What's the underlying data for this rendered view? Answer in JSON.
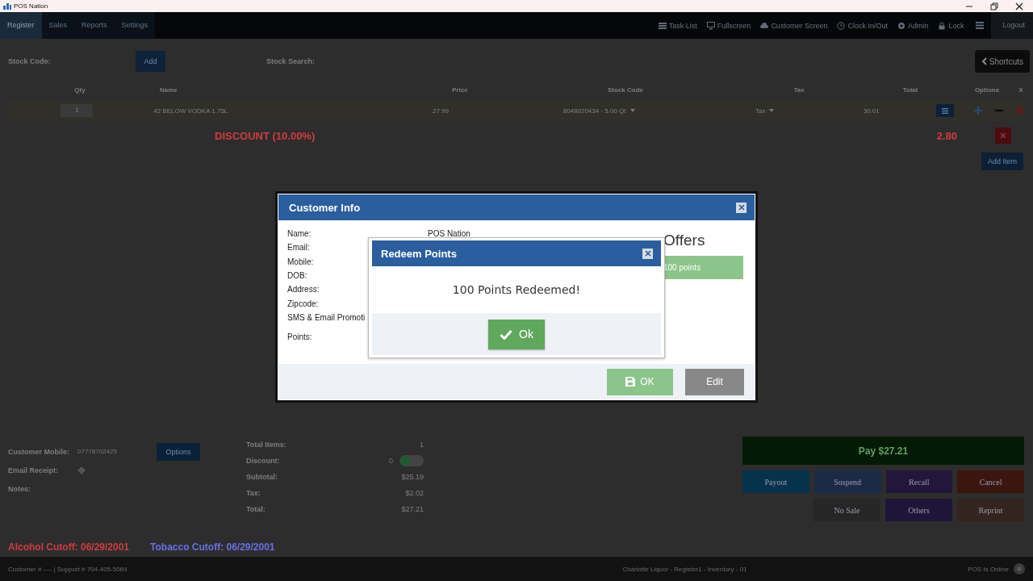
{
  "window": {
    "title": "POS Nation"
  },
  "nav": {
    "tabs": [
      {
        "label": "Register",
        "selected": true
      },
      {
        "label": "Sales",
        "selected": false
      },
      {
        "label": "Reports",
        "selected": false
      },
      {
        "label": "Settings",
        "selected": false
      }
    ],
    "actions": [
      {
        "label": "Task List",
        "kind": "list"
      },
      {
        "label": "Fullscreen",
        "kind": "monitor"
      },
      {
        "label": "Customer Screen",
        "kind": "cloud"
      },
      {
        "label": "Clock In/Out",
        "kind": "clock"
      },
      {
        "label": "Admin",
        "kind": "gear"
      },
      {
        "label": "Lock",
        "kind": "lock"
      }
    ],
    "logout": "Logout"
  },
  "toolbar": {
    "stock_code_label": "Stock Code:",
    "add_button": "Add",
    "stock_search_label": "Stock Search:",
    "shortcuts_button": "Shortcuts"
  },
  "table": {
    "columns": [
      "Qty",
      "Name",
      "Price",
      "Stock Code",
      "Tax",
      "Total",
      "Options",
      "X"
    ],
    "rows": [
      {
        "qty": "1",
        "name": "42 BELOW VODKA 1.75L",
        "price": "27.99",
        "stock_code": "8048020434 · 5.00 Qt",
        "tax": "Tax",
        "total": "30.01"
      }
    ],
    "discount": {
      "label": "DISCOUNT (10.00%)",
      "amount": "2.80"
    },
    "add_item_button": "Add Item"
  },
  "customer": {
    "mobile_label": "Customer Mobile:",
    "mobile_value": "07778702425",
    "options_button": "Options",
    "email_label": "Email Receipt:",
    "notes_label": "Notes:"
  },
  "totals": [
    {
      "label": "Total Items:",
      "value": "1"
    },
    {
      "label": "Discount:",
      "placeholder": "0",
      "kind": "toggle"
    },
    {
      "label": "Subtotal:",
      "value": "$25.19"
    },
    {
      "label": "Tax:",
      "value": "$2.02"
    },
    {
      "label": "Total:",
      "value": "$27.21"
    }
  ],
  "pay_button": "Pay $27.21",
  "action_rows": [
    [
      {
        "label": "Payout",
        "color": "#06334b"
      },
      {
        "label": "Suspend",
        "color": "#1d2a47"
      },
      {
        "label": "Recall",
        "color": "#23163b"
      },
      {
        "label": "Cancel",
        "color": "#3b1610"
      }
    ],
    [
      {
        "label": "No Sale",
        "color": "#262626"
      },
      {
        "label": "Others",
        "color": "#1f1539"
      },
      {
        "label": "Reprint",
        "color": "#34241f"
      }
    ]
  ],
  "cutoffs": [
    {
      "label": "Alcohol Cutoff: 06/29/2001",
      "kind": "alcohol"
    },
    {
      "label": "Tobacco Cutoff: 06/29/2001",
      "kind": "tobacco"
    }
  ],
  "status_bar": {
    "left": "Customer # ---- | Support # 704-405-5069",
    "center": "Charlotte Liquor - Register1 - Inventory - 01",
    "right": "POS Is Online"
  },
  "customer_info": {
    "title": "Customer Info",
    "fields": [
      {
        "label": "Name:",
        "value": "POS Nation"
      },
      {
        "label": "Email:"
      },
      {
        "label": "Mobile:"
      },
      {
        "label": "DOB:"
      },
      {
        "label": "Address:"
      },
      {
        "label": "Zipcode:"
      },
      {
        "label": "SMS & Email Promoti"
      },
      {
        "label": "Points:"
      }
    ],
    "offers_heading": "Offers",
    "offer_button": "100 points",
    "ok_button": "OK",
    "edit_button": "Edit"
  },
  "redeem": {
    "title": "Redeem Points",
    "message": "100 Points Redeemed!",
    "ok_button": "Ok"
  }
}
